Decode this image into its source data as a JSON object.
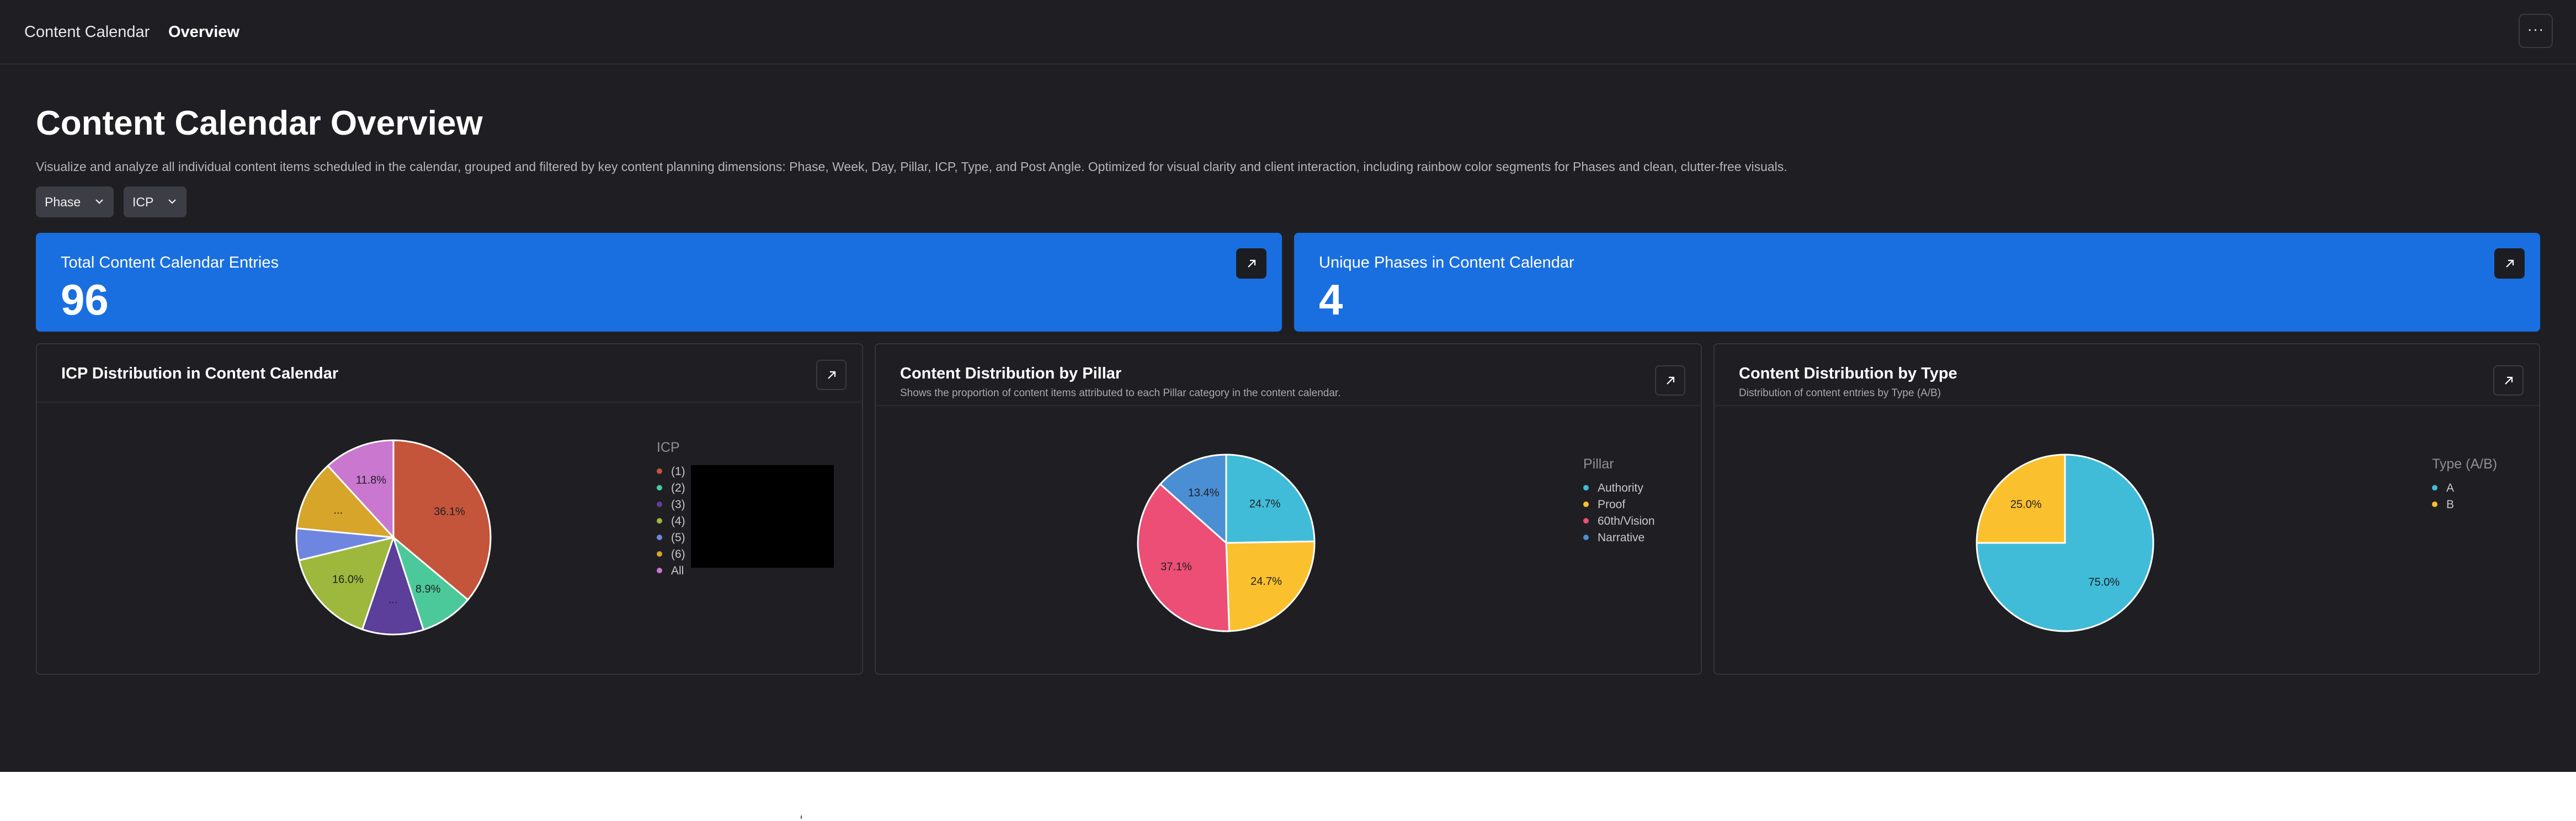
{
  "topbar": {
    "breadcrumb_root": "Content Calendar",
    "breadcrumb_current": "Overview",
    "more_label": "···"
  },
  "page": {
    "title": "Content Calendar Overview",
    "description": "Visualize and analyze all individual content items scheduled in the calendar, grouped and filtered by key content planning dimensions: Phase, Week, Day, Pillar, ICP, Type, and Post Angle. Optimized for visual clarity and client interaction, including rainbow color segments for Phases and clean, clutter-free visuals."
  },
  "filters": [
    {
      "label": "Phase"
    },
    {
      "label": "ICP"
    }
  ],
  "stats": [
    {
      "label": "Total Content Calendar Entries",
      "value": "96"
    },
    {
      "label": "Unique Phases in Content Calendar",
      "value": "4"
    }
  ],
  "colors": {
    "accent_blue": "#1a6fe0",
    "background": "#1f1f23"
  },
  "icons": {
    "expand": "arrow-up-right-icon",
    "chevron": "chevron-down-icon",
    "more": "ellipsis-icon"
  },
  "charts": {
    "icp": {
      "title": "ICP Distribution in Content Calendar",
      "legend_title": "ICP",
      "chart_data": {
        "type": "pie",
        "categories": [
          "(1)",
          "(2)",
          "(3)",
          "(4)",
          "(5)",
          "(6)",
          "All"
        ],
        "values": [
          36.1,
          8.9,
          10.2,
          16.0,
          5.3,
          11.7,
          11.8
        ],
        "labels": [
          "36.1%",
          "8.9%",
          "...",
          "16.0%",
          "",
          "...",
          "11.8%"
        ],
        "colors": [
          "#c4553a",
          "#4cc99a",
          "#5b3f9a",
          "#9db83c",
          "#6f86e0",
          "#d6a52a",
          "#c977cf"
        ]
      }
    },
    "pillar": {
      "title": "Content Distribution by Pillar",
      "subtitle": "Shows the proportion of content items attributed to each Pillar category in the content calendar.",
      "legend_title": "Pillar",
      "chart_data": {
        "type": "pie",
        "categories": [
          "Authority",
          "Proof",
          "60th/Vision",
          "Narrative"
        ],
        "values": [
          24.7,
          24.7,
          37.1,
          13.4
        ],
        "labels": [
          "24.7%",
          "24.7%",
          "37.1%",
          "13.4%"
        ],
        "colors": [
          "#40bcd8",
          "#fbc02d",
          "#ec4e75",
          "#4a8fd4"
        ]
      }
    },
    "type": {
      "title": "Content Distribution by Type",
      "subtitle": "Distribution of content entries by Type (A/B)",
      "legend_title": "Type (A/B)",
      "chart_data": {
        "type": "pie",
        "categories": [
          "A",
          "B"
        ],
        "values": [
          75.0,
          25.0
        ],
        "labels": [
          "75.0%",
          "25.0%"
        ],
        "colors": [
          "#40bcd8",
          "#fbc02d"
        ]
      }
    }
  }
}
